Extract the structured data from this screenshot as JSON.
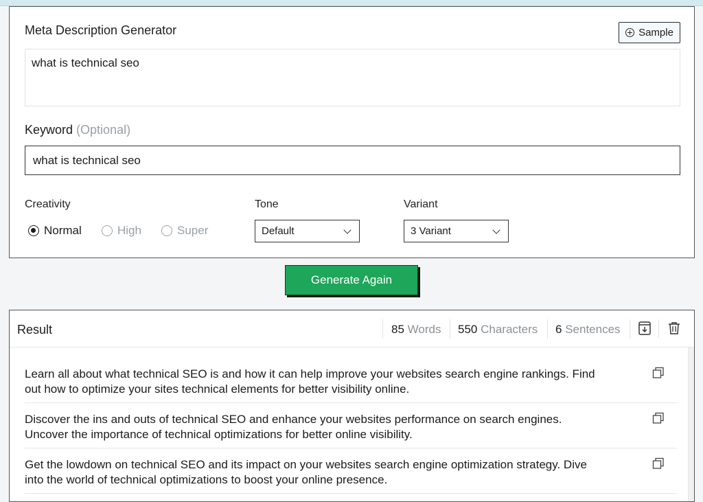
{
  "generator": {
    "title": "Meta Description Generator",
    "sample_label": "Sample",
    "topic_value": "what is technical seo",
    "keyword_label": "Keyword",
    "keyword_optional": "(Optional)",
    "keyword_value": "what is technical seo",
    "creativity": {
      "label": "Creativity",
      "options": [
        "Normal",
        "High",
        "Super"
      ],
      "selected": "Normal"
    },
    "tone": {
      "label": "Tone",
      "value": "Default"
    },
    "variant": {
      "label": "Variant",
      "value": "3 Variant"
    }
  },
  "generate_button": "Generate Again",
  "result": {
    "title": "Result",
    "words_count": "85",
    "words_unit": "Words",
    "chars_count": "550",
    "chars_unit": "Characters",
    "sentences_count": "6",
    "sentences_unit": "Sentences",
    "items": [
      {
        "line1": "Learn all about what technical SEO is and how it can help improve your websites search engine rankings. Find",
        "line2": "out how to optimize your sites technical elements for better visibility online."
      },
      {
        "line1": "Discover the ins and outs of technical SEO and enhance your websites performance on search engines.",
        "line2": "Uncover the importance of technical optimizations for better online visibility."
      },
      {
        "line1": "Get the lowdown on technical SEO and its impact on your websites search engine optimization strategy. Dive",
        "line2": "into the world of technical optimizations to boost your online presence."
      }
    ]
  },
  "icons": {
    "sample": "plus-circle-icon",
    "download": "download-icon",
    "delete": "trash-icon",
    "copy": "copy-icon",
    "chevron": "chevron-down-icon"
  },
  "colors": {
    "accent": "#1ea65a",
    "muted": "#9aa0a6"
  }
}
